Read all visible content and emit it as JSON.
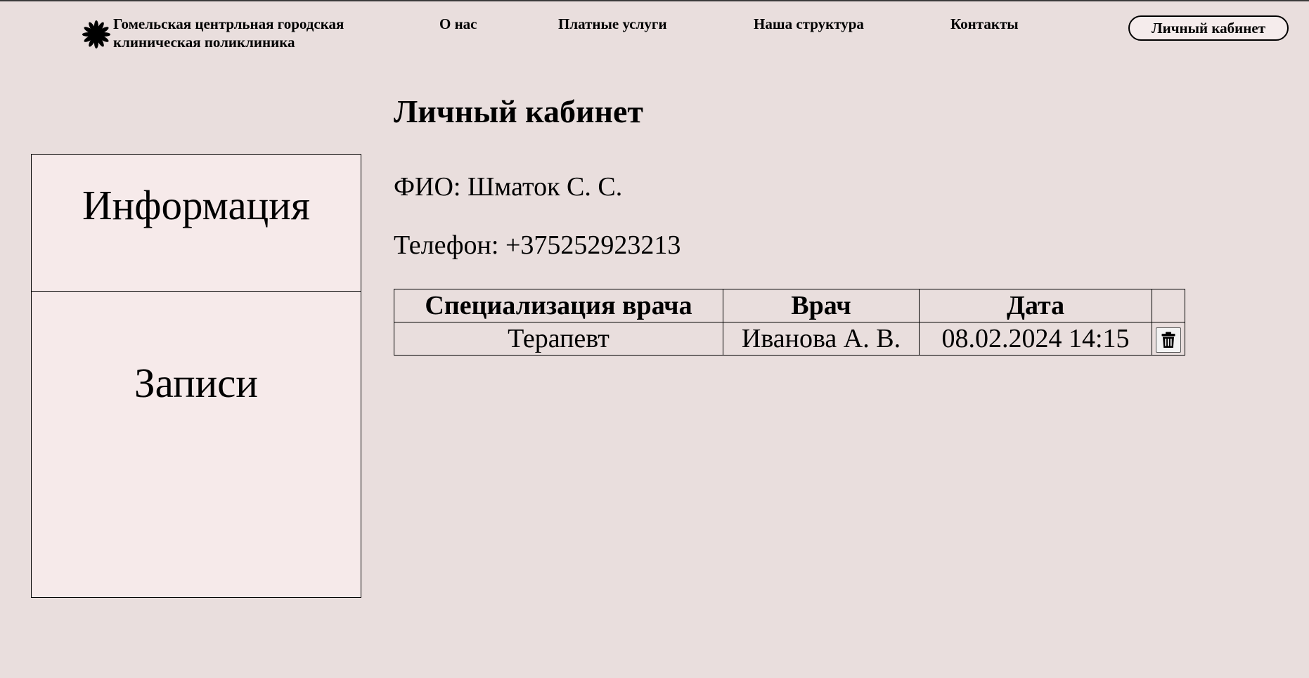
{
  "header": {
    "logo_line1": "Гомельская центрльная городская",
    "logo_line2": "клиническая поликлиника",
    "nav": {
      "about": "О нас",
      "paid_services": "Платные услуги",
      "structure": "Наша структура",
      "contacts": "Контакты"
    },
    "cabinet_button": "Личный кабинет"
  },
  "sidebar": {
    "items": [
      {
        "label": "Информация"
      },
      {
        "label": "Записи"
      }
    ]
  },
  "main": {
    "title": "Личный кабинет",
    "fio": "ФИО: Шматок С. С.",
    "phone": "Телефон: +375252923213",
    "table": {
      "headers": [
        "Специализация врача",
        "Врач",
        "Дата",
        ""
      ],
      "rows": [
        {
          "specialization": "Терапевт",
          "doctor": "Иванова А. В.",
          "date": "08.02.2024 14:15",
          "action_icon": "trash-icon"
        }
      ]
    }
  },
  "colors": {
    "background": "#e9dedd",
    "panel": "#f6eaea",
    "text": "#000000"
  }
}
